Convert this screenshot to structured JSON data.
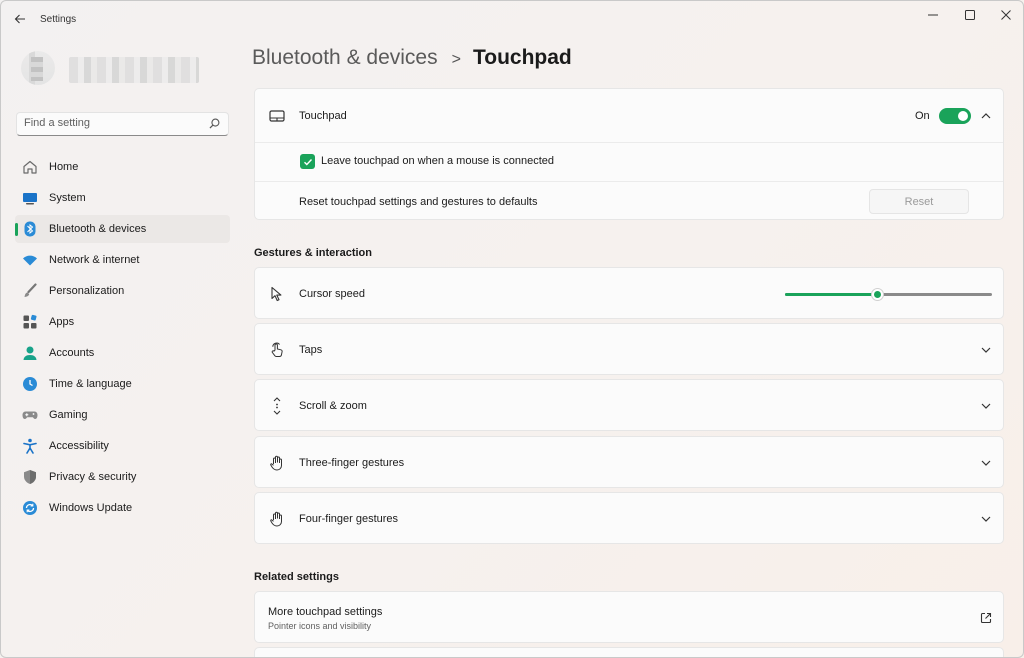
{
  "window": {
    "title": "Settings"
  },
  "search": {
    "placeholder": "Find a setting"
  },
  "nav": {
    "items": [
      {
        "label": "Home"
      },
      {
        "label": "System"
      },
      {
        "label": "Bluetooth & devices"
      },
      {
        "label": "Network & internet"
      },
      {
        "label": "Personalization"
      },
      {
        "label": "Apps"
      },
      {
        "label": "Accounts"
      },
      {
        "label": "Time & language"
      },
      {
        "label": "Gaming"
      },
      {
        "label": "Accessibility"
      },
      {
        "label": "Privacy & security"
      },
      {
        "label": "Windows Update"
      }
    ],
    "active_index": 2
  },
  "breadcrumb": {
    "parent": "Bluetooth & devices",
    "separator": ">",
    "current": "Touchpad"
  },
  "touchpad_card": {
    "label": "Touchpad",
    "toggle_state": "On",
    "toggle_on": true,
    "leave_on_label": "Leave touchpad on when a mouse is connected",
    "leave_on_checked": true,
    "reset_label": "Reset touchpad settings and gestures to defaults",
    "reset_button": "Reset",
    "reset_enabled": false
  },
  "gestures": {
    "title": "Gestures & interaction",
    "cursor_speed_label": "Cursor speed",
    "cursor_speed_fraction": 0.45,
    "items": [
      {
        "label": "Taps",
        "icon": "tap-icon"
      },
      {
        "label": "Scroll & zoom",
        "icon": "scroll-icon"
      },
      {
        "label": "Three-finger gestures",
        "icon": "hand-icon"
      },
      {
        "label": "Four-finger gestures",
        "icon": "hand-icon"
      }
    ]
  },
  "related": {
    "title": "Related settings",
    "more_label": "More touchpad settings",
    "more_sub": "Pointer icons and visibility"
  },
  "colors": {
    "accent": "#1aa35a",
    "background": "#f4f1ef",
    "card": "#fbfbfb"
  }
}
